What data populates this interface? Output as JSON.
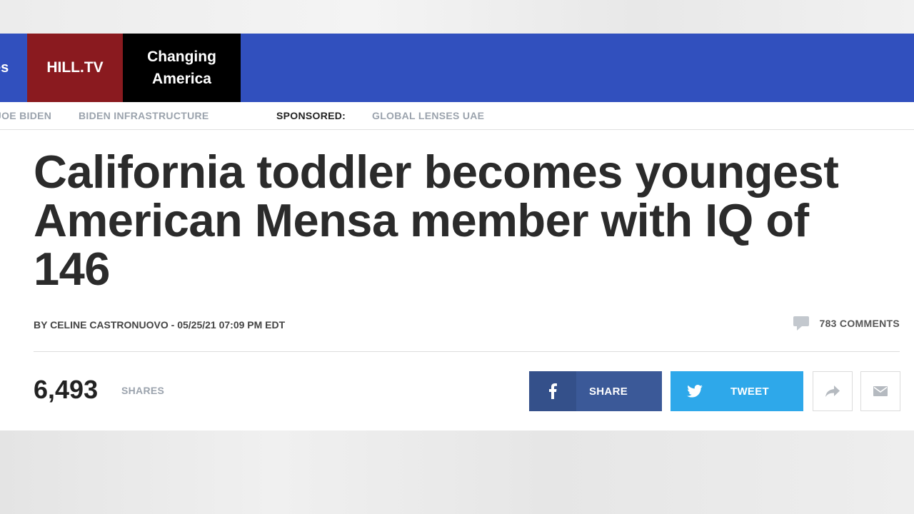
{
  "nav": {
    "partial_item": "es",
    "hilltv": "HILL.TV",
    "changing_america": "Changing America",
    "bg_color": "#3150be",
    "hilltv_color": "#8a1a1f",
    "changing_color": "#000000"
  },
  "subnav": {
    "items": [
      "JOE BIDEN",
      "BIDEN INFRASTRUCTURE"
    ],
    "sponsored_label": "SPONSORED:",
    "sponsored_item": "GLOBAL LENSES UAE"
  },
  "article": {
    "headline": "California toddler becomes youngest American Mensa member with IQ of 146",
    "byline": "BY CELINE CASTRONUOVO - 05/25/21 07:09 PM EDT",
    "comments": "783 COMMENTS",
    "comments_icon": "comment-bubble-icon"
  },
  "share": {
    "count": "6,493",
    "label": "SHARES",
    "facebook_label": "SHARE",
    "facebook_icon": "facebook-icon",
    "facebook_color": "#3b5998",
    "twitter_label": "TWEET",
    "twitter_icon": "twitter-icon",
    "twitter_color": "#2ea8ea",
    "forward_icon": "share-arrow-icon",
    "email_icon": "mail-icon"
  }
}
